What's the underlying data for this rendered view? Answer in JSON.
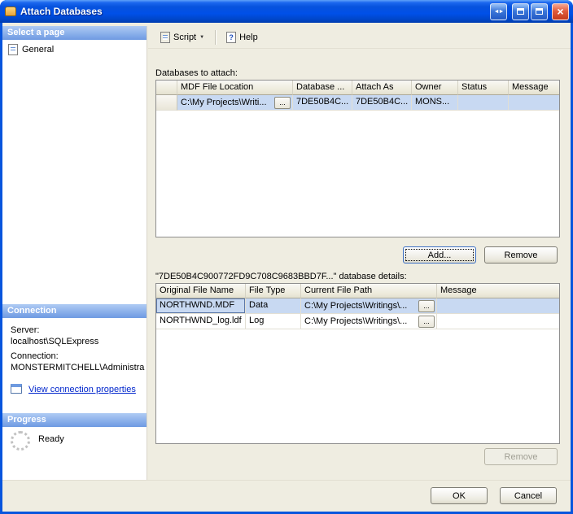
{
  "window": {
    "title": "Attach Databases"
  },
  "icons": {
    "dock_arrows": "◄►",
    "close": "×",
    "dropdown": "▼"
  },
  "sidebar": {
    "select_page_header": "Select a page",
    "pages": [
      {
        "label": "General"
      }
    ],
    "connection_header": "Connection",
    "server_label": "Server:",
    "server_value": "localhost\\SQLExpress",
    "connection_label": "Connection:",
    "connection_value": "MONSTERMITCHELL\\Administra",
    "view_connection_link": "View connection properties",
    "progress_header": "Progress",
    "progress_status": "Ready"
  },
  "toolbar": {
    "script_label": "Script",
    "help_label": "Help"
  },
  "main": {
    "databases_label": "Databases to attach:",
    "databases_table": {
      "columns": [
        "",
        "MDF File Location",
        "Database ...",
        "Attach As",
        "Owner",
        "Status",
        "Message"
      ],
      "rows": [
        {
          "mdf": "C:\\My Projects\\Writi...",
          "browse": "...",
          "database": "7DE50B4C...",
          "attach_as": "7DE50B4C...",
          "owner": "MONS...",
          "status": "",
          "message": ""
        }
      ]
    },
    "add_button": "Add...",
    "remove_button": "Remove",
    "details_label": "\"7DE50B4C900772FD9C708C9683BBD7F...\" database details:",
    "details_table": {
      "columns": [
        "Original File Name",
        "File Type",
        "Current File Path",
        "Message"
      ],
      "rows": [
        {
          "name": "NORTHWND.MDF",
          "type": "Data",
          "path": "C:\\My Projects\\Writings\\...",
          "browse": "...",
          "message": ""
        },
        {
          "name": "NORTHWND_log.ldf",
          "type": "Log",
          "path": "C:\\My Projects\\Writings\\...",
          "browse": "...",
          "message": ""
        }
      ]
    },
    "details_remove_button": "Remove"
  },
  "footer": {
    "ok": "OK",
    "cancel": "Cancel"
  }
}
